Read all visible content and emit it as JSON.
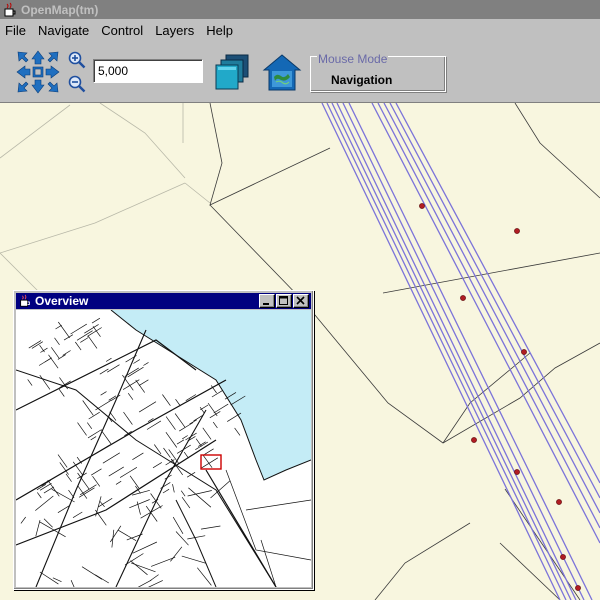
{
  "window": {
    "title": "OpenMap(tm)"
  },
  "menu": [
    "File",
    "Navigate",
    "Control",
    "Layers",
    "Help"
  ],
  "toolbar": {
    "scale_value": "5,000",
    "mouse_mode_legend": "Mouse Mode",
    "mouse_mode_value": "Navigation"
  },
  "overview": {
    "title": "Overview"
  },
  "colors": {
    "map_background": "#f8f6df",
    "map_roads": "#3a3a3a",
    "rail_lines": "#7b73d9",
    "points": "#b01c22",
    "water": "#c4ecf6",
    "overview_marker": "#cc0000"
  },
  "icons": {
    "app": "java-cup-icon",
    "pan": "pan-arrows-icon",
    "zoom_in": "zoom-in-icon",
    "zoom_out": "zoom-out-icon",
    "layers": "layers-stack-icon",
    "layer_panel": "house-map-icon"
  }
}
